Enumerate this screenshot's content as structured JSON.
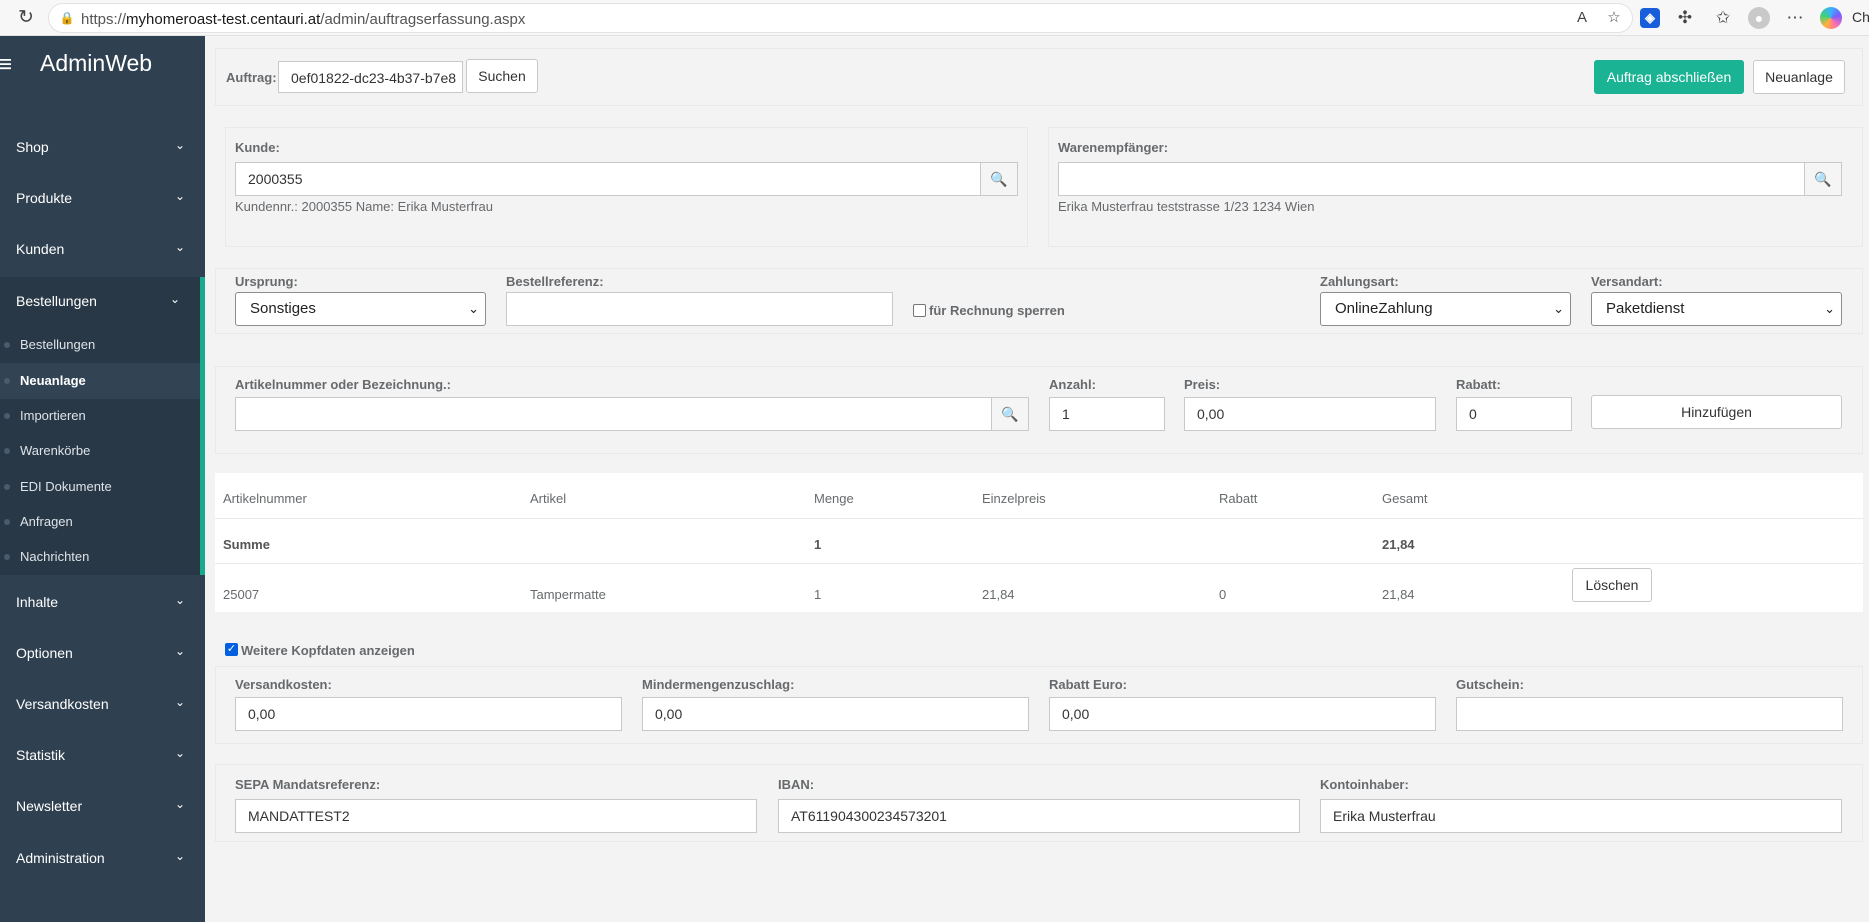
{
  "browser": {
    "url_prefix": "https://",
    "url_host": "myhomeroast-test.centauri.at",
    "url_path": "/admin/auftragserfassung.aspx",
    "copilot_label": "Cha"
  },
  "sidebar": {
    "brand": "AdminWeb",
    "items": [
      {
        "label": "Shop"
      },
      {
        "label": "Produkte"
      },
      {
        "label": "Kunden"
      },
      {
        "label": "Bestellungen"
      },
      {
        "label": "Inhalte"
      },
      {
        "label": "Optionen"
      },
      {
        "label": "Versandkosten"
      },
      {
        "label": "Statistik"
      },
      {
        "label": "Newsletter"
      },
      {
        "label": "Administration"
      }
    ],
    "sub_items": [
      {
        "label": "Bestellungen"
      },
      {
        "label": "Neuanlage"
      },
      {
        "label": "Importieren"
      },
      {
        "label": "Warenkörbe"
      },
      {
        "label": "EDI Dokumente"
      },
      {
        "label": "Anfragen"
      },
      {
        "label": "Nachrichten"
      }
    ]
  },
  "toolbar": {
    "auftrag_label": "Auftrag:",
    "auftrag_value": "0ef01822-dc23-4b37-b7e8",
    "search_button": "Suchen",
    "complete_button": "Auftrag abschließen",
    "new_button": "Neuanlage"
  },
  "customer": {
    "label": "Kunde:",
    "value": "2000355",
    "info": "Kundennr.: 2000355 Name: Erika Musterfrau"
  },
  "recipient": {
    "label": "Warenempfänger:",
    "value": "",
    "info": "Erika Musterfrau teststrasse 1/23 1234 Wien"
  },
  "order": {
    "origin_label": "Ursprung:",
    "origin_value": "Sonstiges",
    "reference_label": "Bestellreferenz:",
    "reference_value": "",
    "lock_label": "für Rechnung sperren",
    "payment_label": "Zahlungsart:",
    "payment_value": "OnlineZahlung",
    "shipping_label": "Versandart:",
    "shipping_value": "Paketdienst"
  },
  "article": {
    "search_label": "Artikelnummer oder Bezeichnung.:",
    "search_value": "",
    "qty_label": "Anzahl:",
    "qty_value": "1",
    "price_label": "Preis:",
    "price_value": "0,00",
    "discount_label": "Rabatt:",
    "discount_value": "0",
    "add_button": "Hinzufügen"
  },
  "table": {
    "headers": [
      "Artikelnummer",
      "Artikel",
      "Menge",
      "Einzelpreis",
      "Rabatt",
      "Gesamt"
    ],
    "sum_row": {
      "label": "Summe",
      "qty": "1",
      "total": "21,84"
    },
    "rows": [
      {
        "nr": "25007",
        "article": "Tampermatte",
        "qty": "1",
        "price": "21,84",
        "discount": "0",
        "total": "21,84"
      }
    ],
    "delete_button": "Löschen"
  },
  "more": {
    "toggle_label": "Weitere Kopfdaten anzeigen",
    "shipping_cost_label": "Versandkosten:",
    "shipping_cost_value": "0,00",
    "min_surcharge_label": "Mindermengenzuschlag:",
    "min_surcharge_value": "0,00",
    "discount_euro_label": "Rabatt Euro:",
    "discount_euro_value": "0,00",
    "voucher_label": "Gutschein:",
    "voucher_value": ""
  },
  "sepa": {
    "mandate_label": "SEPA Mandatsreferenz:",
    "mandate_value": "MANDATTEST2",
    "iban_label": "IBAN:",
    "iban_value": "AT611904300234573201",
    "holder_label": "Kontoinhaber:",
    "holder_value": "Erika Musterfrau"
  }
}
